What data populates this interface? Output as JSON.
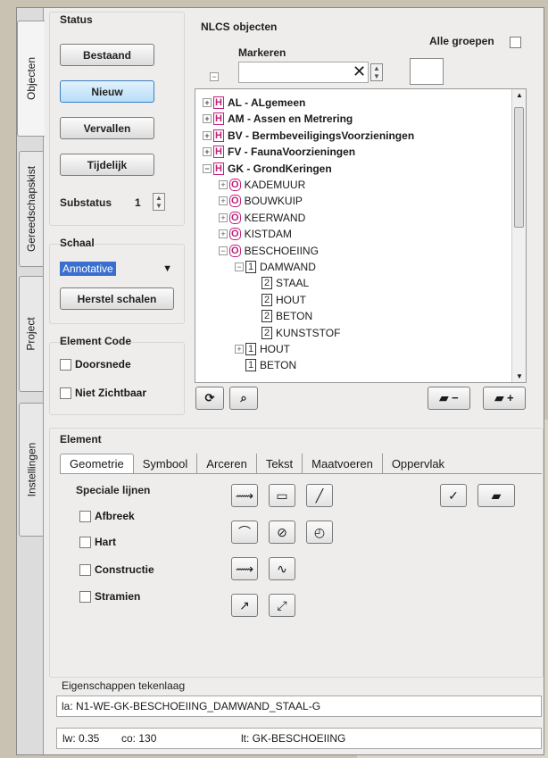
{
  "vertical_tabs": [
    "Objecten",
    "Gereedschapskist",
    "Project",
    "Instellingen"
  ],
  "status": {
    "label": "Status",
    "buttons": [
      "Bestaand",
      "Nieuw",
      "Vervallen",
      "Tijdelijk"
    ],
    "selected": "Nieuw",
    "substatus_label": "Substatus",
    "substatus_value": "1"
  },
  "schaal": {
    "label": "Schaal",
    "selected": "Annotative",
    "reset_button": "Herstel schalen"
  },
  "element_code": {
    "label": "Element Code",
    "options": [
      "Doorsnede",
      "Niet Zichtbaar"
    ]
  },
  "nlcs": {
    "label": "NLCS objecten",
    "markeren_label": "Markeren",
    "alle_groepen_label": "Alle groepen",
    "search_value": "",
    "tree": [
      {
        "level": 0,
        "expander": "+",
        "icon": "H",
        "code": "AL",
        "text": "AL - ALgemeen"
      },
      {
        "level": 0,
        "expander": "+",
        "icon": "H",
        "code": "AM",
        "text": "AM - Assen en Metrering"
      },
      {
        "level": 0,
        "expander": "+",
        "icon": "H",
        "code": "BV",
        "text": "BV - BermbeveiligingsVoorzieningen"
      },
      {
        "level": 0,
        "expander": "+",
        "icon": "H",
        "code": "FV",
        "text": "FV - FaunaVoorzieningen"
      },
      {
        "level": 0,
        "expander": "-",
        "icon": "H",
        "code": "GK",
        "text": "GK - GrondKeringen"
      },
      {
        "level": 1,
        "expander": "+",
        "icon": "O",
        "text": "KADEMUUR"
      },
      {
        "level": 1,
        "expander": "+",
        "icon": "O",
        "text": "BOUWKUIP"
      },
      {
        "level": 1,
        "expander": "+",
        "icon": "O",
        "text": "KEERWAND"
      },
      {
        "level": 1,
        "expander": "+",
        "icon": "O",
        "text": "KISTDAM"
      },
      {
        "level": 1,
        "expander": "-",
        "icon": "O",
        "text": "BESCHOEIING"
      },
      {
        "level": 2,
        "expander": "-",
        "icon": "1",
        "text": "DAMWAND"
      },
      {
        "level": 3,
        "expander": "",
        "icon": "2",
        "text": "STAAL"
      },
      {
        "level": 3,
        "expander": "",
        "icon": "2",
        "text": "HOUT"
      },
      {
        "level": 3,
        "expander": "",
        "icon": "2",
        "text": "BETON"
      },
      {
        "level": 3,
        "expander": "",
        "icon": "2",
        "text": "KUNSTSTOF"
      },
      {
        "level": 2,
        "expander": "+",
        "icon": "1",
        "text": "HOUT"
      },
      {
        "level": 2,
        "expander": "",
        "icon": "1",
        "text": "BETON"
      }
    ]
  },
  "element": {
    "label": "Element",
    "tabs": [
      "Geometrie",
      "Symbool",
      "Arceren",
      "Tekst",
      "Maatvoeren",
      "Oppervlak"
    ],
    "active_tab": "Geometrie",
    "speciale_lijnen_label": "Speciale lijnen",
    "speciale_lijnen": [
      "Afbreek",
      "Hart",
      "Constructie",
      "Stramien"
    ]
  },
  "eigenschappen": {
    "label": "Eigenschappen tekenlaag",
    "layer": "la: N1-WE-GK-BESCHOEIING_DAMWAND_STAAL-G",
    "lineweight": "lw: 0.35",
    "color": "co: 130",
    "linetype": "lt: GK-BESCHOEIING"
  },
  "icons": {
    "clear": "close-icon",
    "tree_actions": [
      "tree-mark-icon",
      "tree-find-icon"
    ],
    "layer_actions": [
      "layer-minus-icon",
      "layer-plus-icon"
    ],
    "geometry_tools": [
      "polyline-arrow-icon",
      "rectangle-icon",
      "line-icon",
      "arc-icon",
      "circle-center-icon",
      "circle-radius-icon",
      "polyline-arrow-2-icon",
      "spline-icon",
      "arrow-line-icon",
      "dimension-line-icon"
    ]
  },
  "colors": {
    "selected_button": "#b7def8",
    "tree_icon_accent": "#c0207d",
    "schaal_select_bg": "#3a6fd0"
  }
}
